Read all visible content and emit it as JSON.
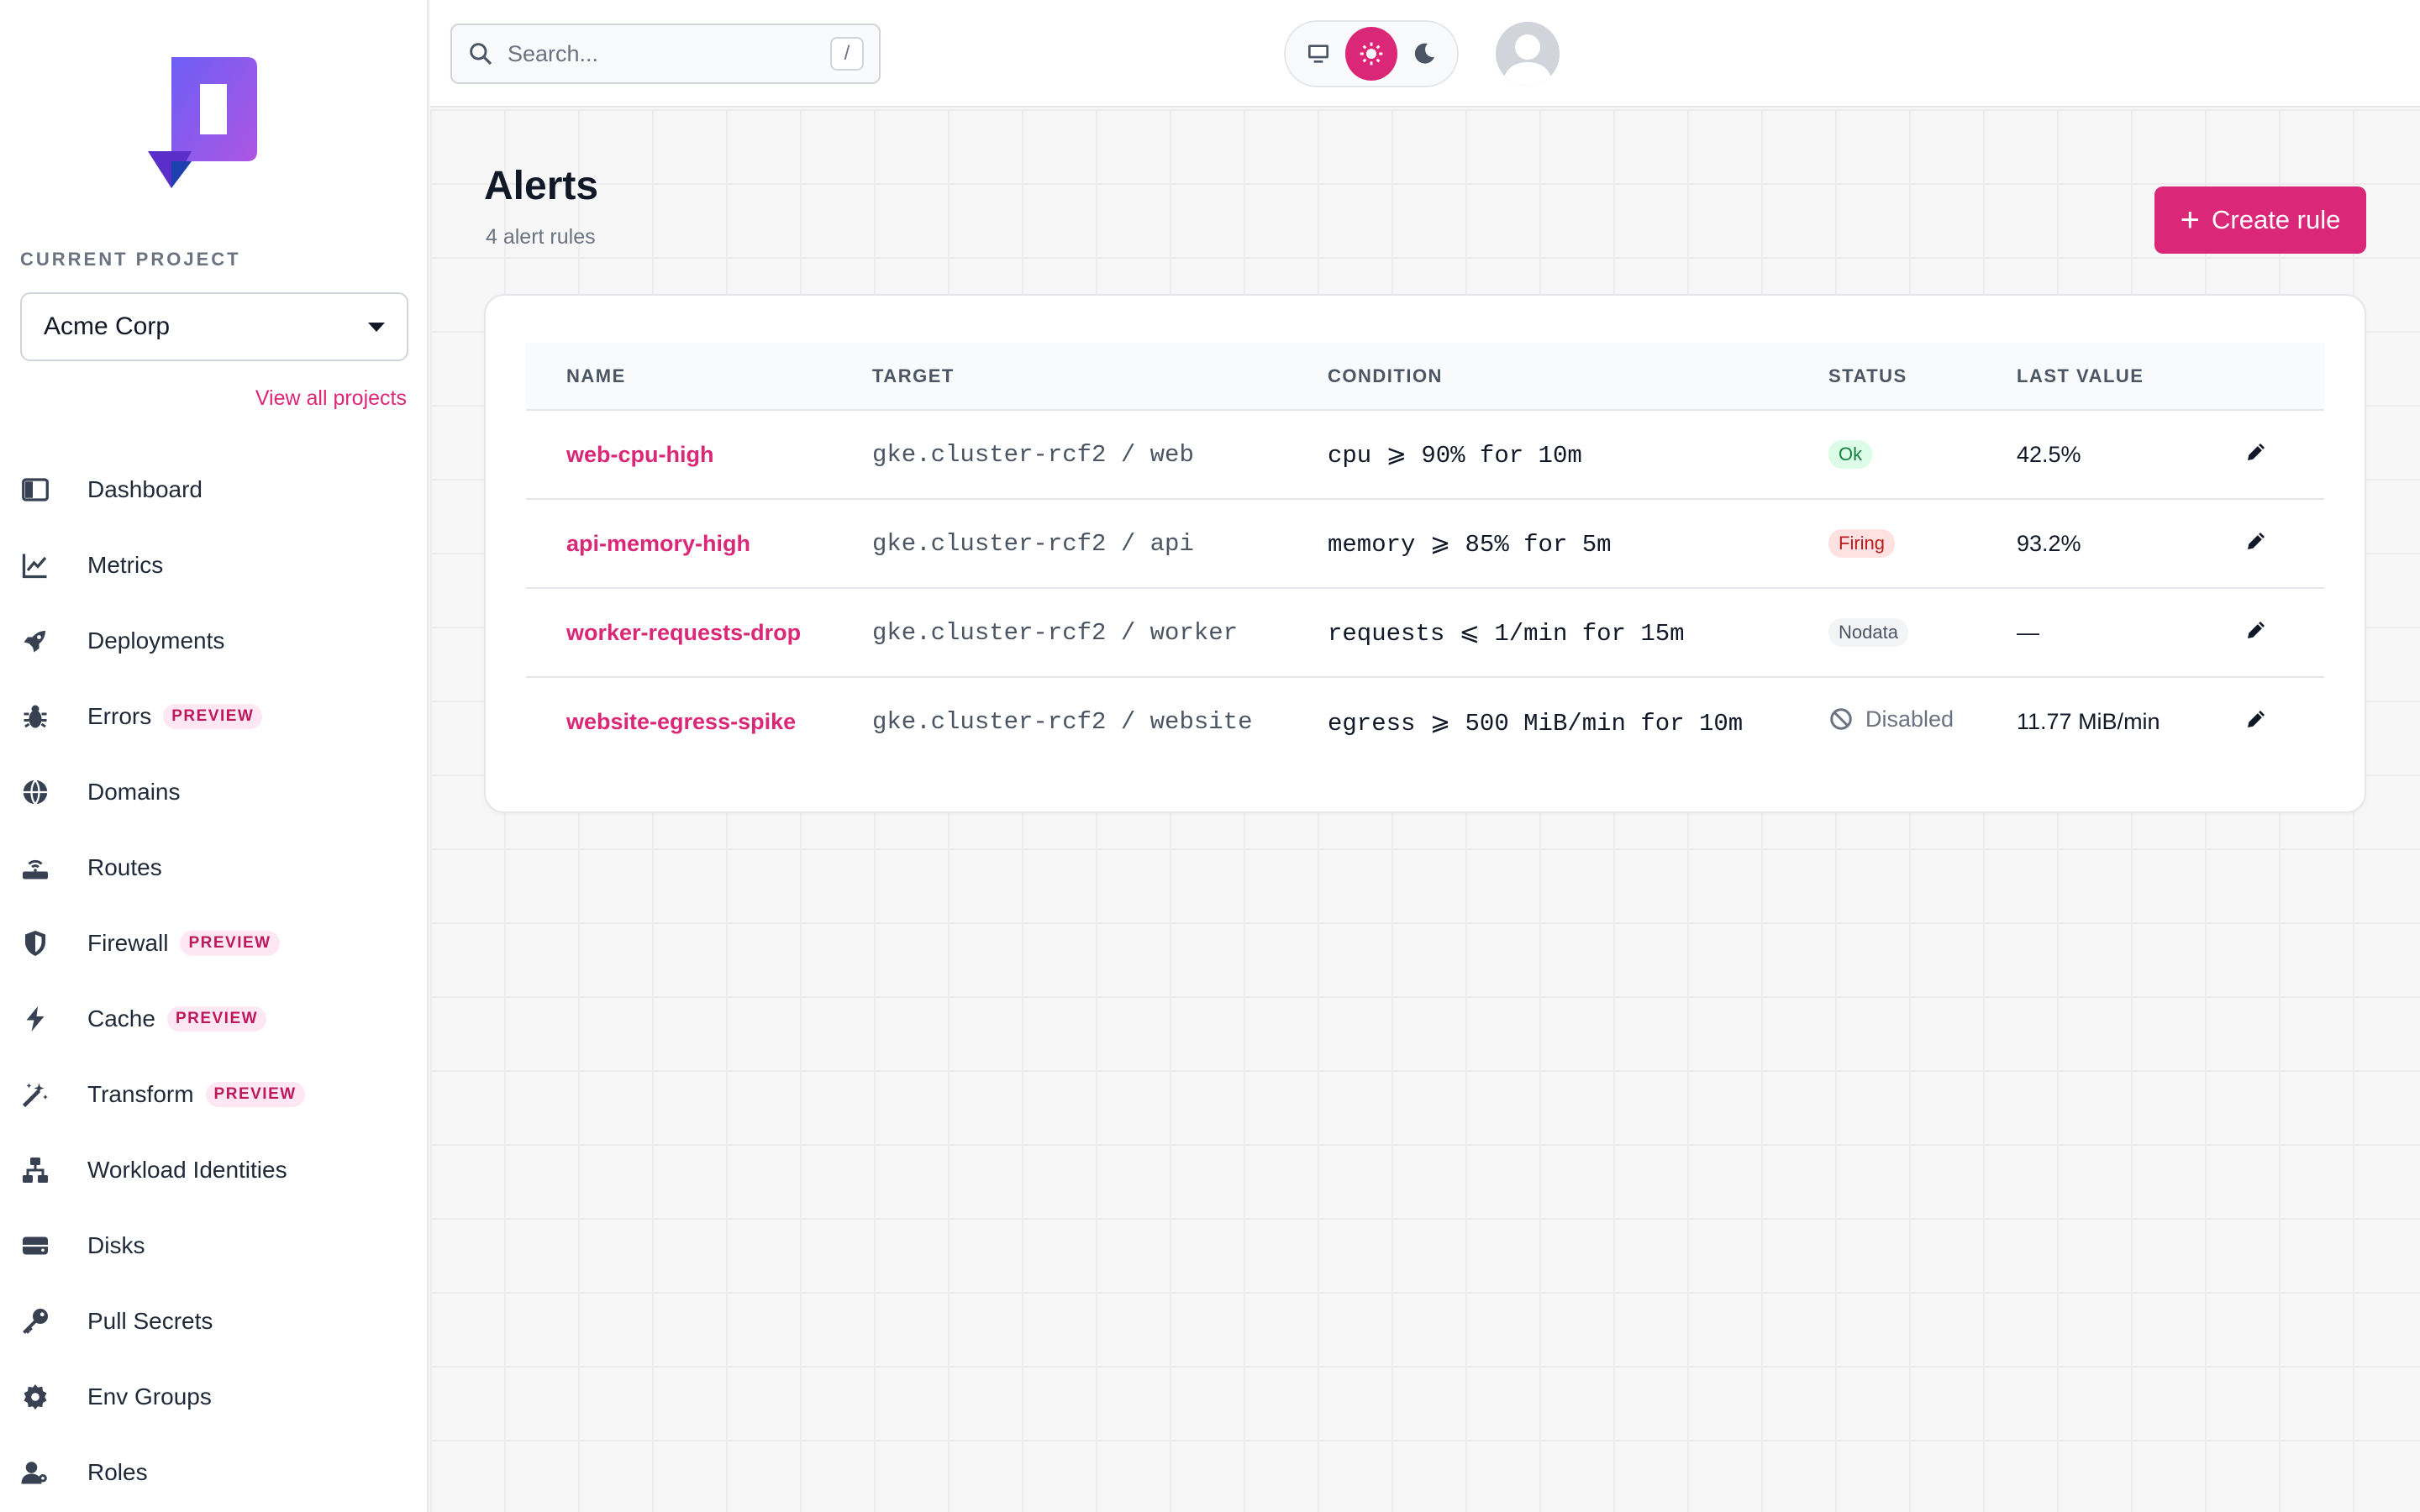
{
  "sidebar": {
    "project_heading": "CURRENT PROJECT",
    "project_name": "Acme Corp",
    "view_all": "View all projects",
    "items": [
      {
        "label": "Dashboard",
        "icon": "dashboard-icon"
      },
      {
        "label": "Metrics",
        "icon": "metrics-icon"
      },
      {
        "label": "Deployments",
        "icon": "rocket-icon"
      },
      {
        "label": "Errors",
        "icon": "bug-icon",
        "badge": "PREVIEW"
      },
      {
        "label": "Domains",
        "icon": "globe-icon"
      },
      {
        "label": "Routes",
        "icon": "router-icon"
      },
      {
        "label": "Firewall",
        "icon": "shield-icon",
        "badge": "PREVIEW"
      },
      {
        "label": "Cache",
        "icon": "bolt-icon",
        "badge": "PREVIEW"
      },
      {
        "label": "Transform",
        "icon": "magic-wand-icon",
        "badge": "PREVIEW"
      },
      {
        "label": "Workload Identities",
        "icon": "network-icon"
      },
      {
        "label": "Disks",
        "icon": "disk-icon"
      },
      {
        "label": "Pull Secrets",
        "icon": "key-icon"
      },
      {
        "label": "Env Groups",
        "icon": "gear-icon"
      },
      {
        "label": "Roles",
        "icon": "users-icon"
      }
    ]
  },
  "topbar": {
    "search_placeholder": "Search...",
    "search_shortcut": "/",
    "theme_options": [
      "system",
      "light",
      "dark"
    ],
    "theme_selected": "light"
  },
  "page": {
    "title": "Alerts",
    "subtitle": "4 alert rules",
    "create_label": "Create rule"
  },
  "table": {
    "columns": [
      "NAME",
      "TARGET",
      "CONDITION",
      "STATUS",
      "LAST VALUE"
    ],
    "rows": [
      {
        "name": "web-cpu-high",
        "target": "gke.cluster-rcf2 / web",
        "condition": "cpu ⩾ 90% for 10m",
        "status": "Ok",
        "last_value": "42.5%"
      },
      {
        "name": "api-memory-high",
        "target": "gke.cluster-rcf2 / api",
        "condition": "memory ⩾ 85% for 5m",
        "status": "Firing",
        "last_value": "93.2%"
      },
      {
        "name": "worker-requests-drop",
        "target": "gke.cluster-rcf2 / worker",
        "condition": "requests ⩽ 1/min for 15m",
        "status": "Nodata",
        "last_value": "—"
      },
      {
        "name": "website-egress-spike",
        "target": "gke.cluster-rcf2 / website",
        "condition": "egress ⩾ 500 MiB/min for 10m",
        "status": "Disabled",
        "last_value": "11.77 MiB/min"
      }
    ]
  },
  "colors": {
    "accent": "#db2777",
    "ok": "#15803d",
    "firing": "#b91c1c"
  }
}
